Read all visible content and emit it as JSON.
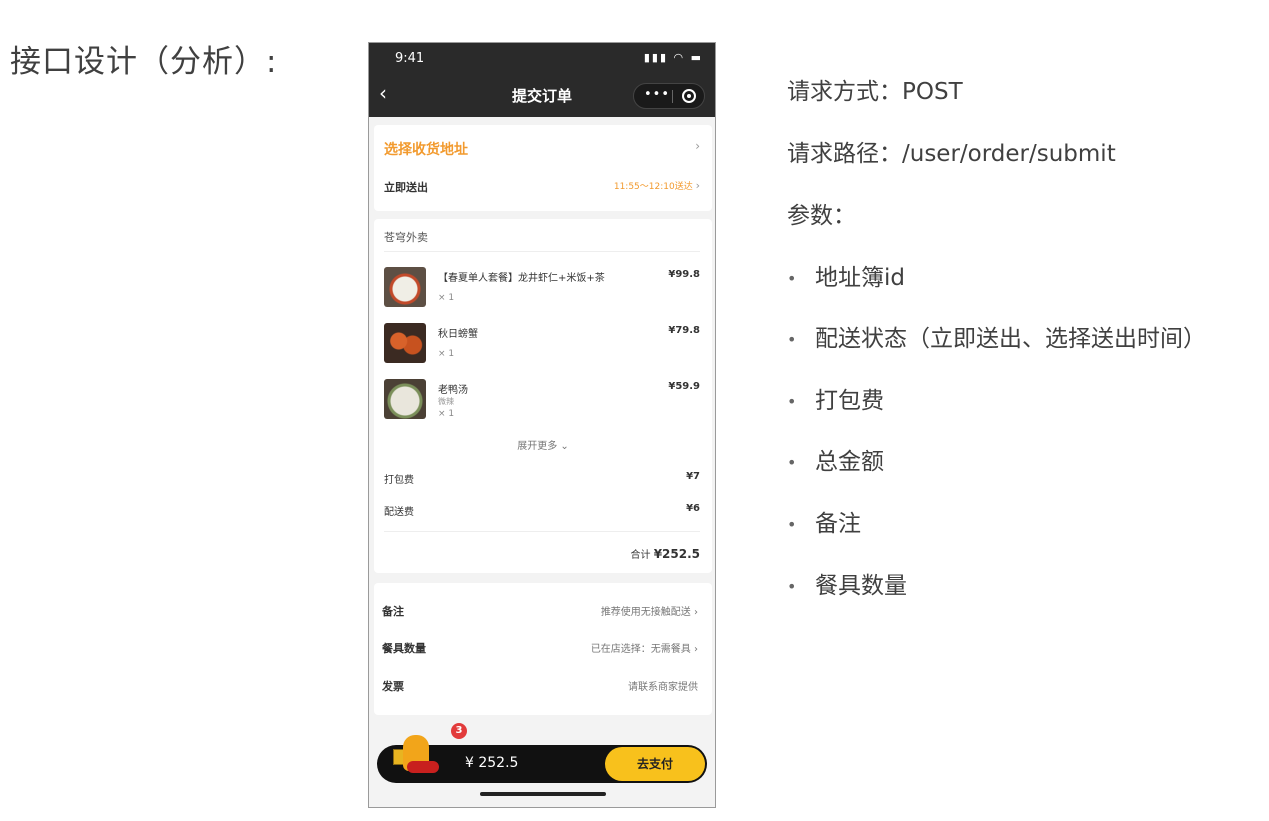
{
  "slide": {
    "title": "接口设计（分析）:"
  },
  "phone": {
    "status_time": "9:41",
    "status_icons": "▮▮▮ ◠ ▬",
    "nav_title": "提交订单",
    "nav_more": "•••",
    "address": {
      "label": "选择收货地址",
      "chevron": "›"
    },
    "delivery": {
      "label": "立即送出",
      "time": "11:55～12:10送达",
      "chevron": "›"
    },
    "shop_name": "苍穹外卖",
    "items": [
      {
        "name": "【春夏单人套餐】龙井虾仁+米饭+茶",
        "sub": "",
        "qty": "× 1",
        "price": "¥99.8",
        "thumb": "dish-shrimp"
      },
      {
        "name": "秋日螃蟹",
        "sub": "",
        "qty": "× 1",
        "price": "¥79.8",
        "thumb": "dish-crab"
      },
      {
        "name": "老鸭汤",
        "sub": "微辣",
        "qty": "× 1",
        "price": "¥59.9",
        "thumb": "dish-soup"
      }
    ],
    "expand_more": "展开更多 ⌄",
    "packing_fee": {
      "label": "打包费",
      "value": "¥7"
    },
    "delivery_fee": {
      "label": "配送费",
      "value": "¥6"
    },
    "total": {
      "label": "合计",
      "value": "¥252.5"
    },
    "options": [
      {
        "label": "备注",
        "value": "推荐使用无接触配送 ›"
      },
      {
        "label": "餐具数量",
        "value": "已在店选择：无需餐具 ›"
      },
      {
        "label": "发票",
        "value": "请联系商家提供"
      }
    ],
    "pay": {
      "amount": "¥ 252.5",
      "button": "去支付",
      "badge": "3"
    }
  },
  "spec": {
    "method": "请求方式：POST",
    "path": "请求路径：/user/order/submit",
    "params_label": "参数：",
    "params": [
      "地址簿id",
      "配送状态（立即送出、选择送出时间）",
      "打包费",
      "总金额",
      "备注",
      "餐具数量"
    ]
  }
}
